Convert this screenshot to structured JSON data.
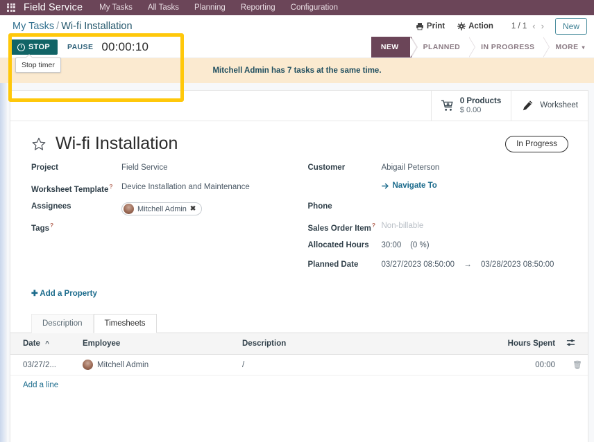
{
  "appbar": {
    "apps_icon": "apps-grid-icon",
    "brand": "Field Service",
    "menu": [
      "My Tasks",
      "All Tasks",
      "Planning",
      "Reporting",
      "Configuration"
    ]
  },
  "control_panel": {
    "breadcrumb": {
      "parent": "My Tasks",
      "separator": "/",
      "current": "Wi-fi Installation"
    },
    "print_label": "Print",
    "action_label": "Action",
    "pager": "1 / 1",
    "prev_icon": "chevron-left-icon",
    "next_icon": "chevron-right-icon",
    "new_label": "New"
  },
  "timer": {
    "stop_label": "STOP",
    "stop_icon": "clock-icon",
    "pause_label": "PAUSE",
    "elapsed": "00:00:10",
    "tooltip": "Stop timer"
  },
  "statusbar": {
    "stages": [
      "NEW",
      "PLANNED",
      "IN PROGRESS",
      "MORE"
    ],
    "active_index": 0,
    "more_caret": "▾"
  },
  "highlight": {
    "color": "#FFC80A"
  },
  "alert": {
    "message": "Mitchell Admin has 7 tasks at the same time."
  },
  "stat_buttons": [
    {
      "icon": "cart-plus-icon",
      "line1": "0 Products",
      "line2": "$ 0.00"
    },
    {
      "icon": "pencil-icon",
      "line1": "Worksheet",
      "line2": ""
    }
  ],
  "record": {
    "star_icon": "star-outline-icon",
    "title": "Wi-fi Installation",
    "status_badge": "In Progress"
  },
  "form": {
    "left": [
      {
        "label": "Project",
        "help": false,
        "value": "Field Service",
        "type": "text"
      },
      {
        "label": "Worksheet Template",
        "help": true,
        "value": "Device Installation and Maintenance",
        "type": "text"
      },
      {
        "label": "Assignees",
        "help": false,
        "value": "Mitchell Admin",
        "type": "tag",
        "remove_icon": "close-icon"
      },
      {
        "label": "Tags",
        "help": true,
        "value": "",
        "type": "text"
      }
    ],
    "right": [
      {
        "label": "Customer",
        "help": false,
        "value": "Abigail Peterson",
        "type": "text"
      },
      {
        "label": "",
        "help": false,
        "value": "Navigate To",
        "type": "link",
        "icon": "arrow-right-icon"
      },
      {
        "label": "Phone",
        "help": false,
        "value": "",
        "type": "text"
      },
      {
        "label": "Sales Order Item",
        "help": true,
        "value": "Non-billable",
        "type": "placeholder"
      },
      {
        "label": "Allocated Hours",
        "help": false,
        "value": "30:00",
        "extra": "(0 %)",
        "type": "text"
      },
      {
        "label": "Planned Date",
        "help": false,
        "value": "03/27/2023 08:50:00",
        "arrow": "→",
        "value2": "03/28/2023 08:50:00",
        "type": "range"
      }
    ],
    "add_property": "Add a Property",
    "add_property_icon": "plus-icon"
  },
  "notebook": {
    "tabs": [
      {
        "label": "Description",
        "active": false
      },
      {
        "label": "Timesheets",
        "active": true
      }
    ]
  },
  "timesheets": {
    "columns": [
      "Date",
      "Employee",
      "Description",
      "Hours Spent"
    ],
    "sort_column": "Date",
    "sort_icon": "caret-up-icon",
    "options_icon": "column-options-icon",
    "rows": [
      {
        "date": "03/27/2...",
        "employee": "Mitchell Admin",
        "employee_avatar": "user-avatar",
        "description": "/",
        "hours": "00:00",
        "delete_icon": "trash-icon"
      }
    ],
    "add_line": "Add a line"
  }
}
